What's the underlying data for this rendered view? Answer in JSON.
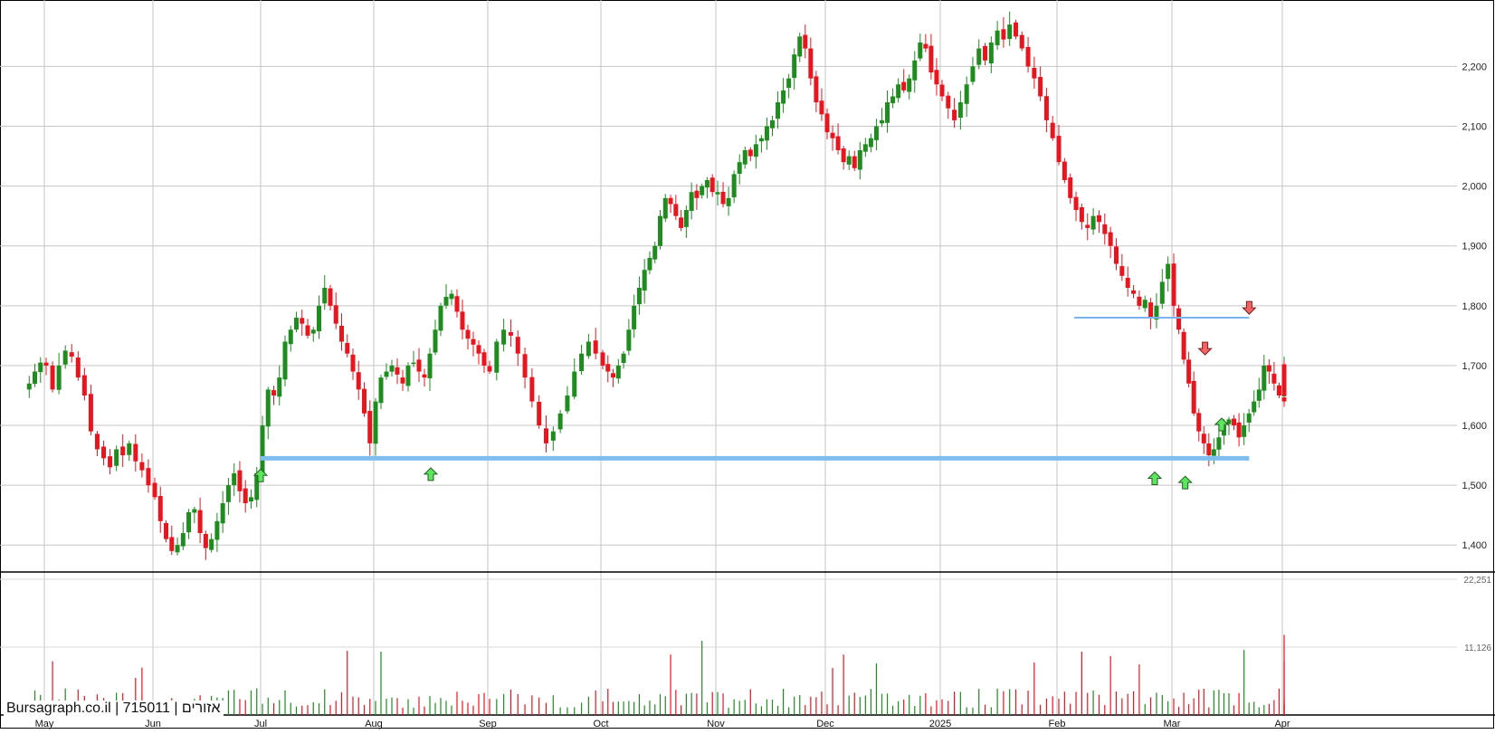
{
  "watermark": "Bursagraph.co.il | 715011 | אזורים",
  "chart_data": {
    "type": "candlestick",
    "title": "",
    "xlabel": "",
    "ylabel": "",
    "x_tick_labels": [
      "May",
      "Jun",
      "Jul",
      "Aug",
      "Sep",
      "Oct",
      "Nov",
      "Dec",
      "2025",
      "Feb",
      "Mar",
      "Apr"
    ],
    "price_axis": {
      "ticks": [
        1400,
        1500,
        1600,
        1700,
        1800,
        1900,
        2000,
        2100,
        2200
      ],
      "range": [
        1358,
        2305
      ],
      "grid": true,
      "side": "right"
    },
    "volume_axis": {
      "tick_labels": [
        "11,126",
        "22,251"
      ],
      "ticks": [
        11126,
        22251
      ],
      "range": [
        0,
        22251
      ]
    },
    "colors": {
      "up": "#1e8c1e",
      "down": "#e8141e",
      "grid": "#c6c6c6",
      "support": "#7fbef0",
      "resistance": "#78b4ee",
      "arrow_up": "#5de65d",
      "arrow_down": "#f06464"
    },
    "support_line": {
      "price": 1545,
      "from_month": 3.0,
      "to_month": 11.7
    },
    "resistance_line": {
      "price": 1780,
      "from_month": 10.15,
      "to_month": 11.7
    },
    "signals": [
      {
        "type": "up",
        "month": 3.0,
        "price": 1515
      },
      {
        "type": "up",
        "month": 4.5,
        "price": 1517
      },
      {
        "type": "up",
        "month": 10.85,
        "price": 1510
      },
      {
        "type": "up",
        "month": 11.12,
        "price": 1503
      },
      {
        "type": "up",
        "month": 11.45,
        "price": 1600
      },
      {
        "type": "down",
        "month": 11.3,
        "price": 1730
      },
      {
        "type": "down",
        "month": 11.7,
        "price": 1798
      }
    ],
    "months": [
      {
        "label": "Apr",
        "closes": [
          1670,
          1690,
          1705
        ]
      },
      {
        "label": "May",
        "closes": [
          1700,
          1660,
          1700,
          1725,
          1715,
          1680,
          1650,
          1590,
          1560,
          1545,
          1530,
          1560,
          1550,
          1570,
          1540,
          1525,
          1500
        ]
      },
      {
        "label": "Jun",
        "closes": [
          1480,
          1440,
          1410,
          1390,
          1400,
          1420,
          1455,
          1460,
          1420,
          1395,
          1410,
          1440,
          1470,
          1500,
          1520,
          1490,
          1470,
          1480,
          1520
        ]
      },
      {
        "label": "Jul",
        "closes": [
          1600,
          1660,
          1650,
          1680,
          1740,
          1760,
          1780,
          1770,
          1750,
          1760,
          1800,
          1830,
          1800,
          1770,
          1740,
          1720,
          1690,
          1660,
          1620,
          1570
        ]
      },
      {
        "label": "Aug",
        "closes": [
          1640,
          1680,
          1690,
          1700,
          1685,
          1670,
          1700,
          1705,
          1690,
          1680,
          1720,
          1760,
          1800,
          1815,
          1820,
          1790,
          1760,
          1745,
          1735,
          1720,
          1700
        ]
      },
      {
        "label": "Sep",
        "closes": [
          1690,
          1740,
          1760,
          1750,
          1720,
          1680,
          1640,
          1600,
          1570,
          1590,
          1620,
          1650,
          1690,
          1720,
          1740,
          1720
        ]
      },
      {
        "label": "Oct",
        "closes": [
          1700,
          1690,
          1680,
          1700,
          1720,
          1760,
          1800,
          1830,
          1860,
          1880,
          1900,
          1950,
          1980,
          1970,
          1950,
          1930,
          1960,
          1990,
          1980,
          2000,
          2010,
          1990
        ]
      },
      {
        "label": "Nov",
        "closes": [
          1990,
          1970,
          1980,
          2020,
          2040,
          2060,
          2050,
          2070,
          2080,
          2100,
          2110,
          2140,
          2160,
          2180,
          2220,
          2250,
          2230,
          2180,
          2140,
          2120
        ]
      },
      {
        "label": "Dec",
        "closes": [
          2090,
          2080,
          2060,
          2040,
          2050,
          2030,
          2060,
          2070,
          2080,
          2100,
          2110,
          2140,
          2150,
          2170,
          2160,
          2180,
          2210,
          2240,
          2230,
          2190,
          2170
        ]
      },
      {
        "label": "2025",
        "closes": [
          2150,
          2130,
          2110,
          2140,
          2170,
          2200,
          2230,
          2210,
          2240,
          2260,
          2245,
          2270,
          2250,
          2230,
          2200,
          2180,
          2150,
          2110,
          2080
        ]
      },
      {
        "label": "Feb",
        "closes": [
          2040,
          2010,
          1980,
          1960,
          1940,
          1930,
          1950,
          1940,
          1920,
          1900,
          1870,
          1850,
          1830,
          1820,
          1800,
          1810,
          1780,
          1800,
          1840,
          1870
        ]
      },
      {
        "label": "Mar",
        "closes": [
          1800,
          1760,
          1710,
          1670,
          1620,
          1590,
          1570,
          1550,
          1560,
          1580,
          1600,
          1610,
          1600,
          1580,
          1600,
          1620,
          1640,
          1660,
          1700,
          1690,
          1670,
          1650
        ]
      },
      {
        "label": "Apr",
        "closes": [
          1680,
          1700,
          1680,
          1650,
          1640
        ]
      }
    ]
  }
}
